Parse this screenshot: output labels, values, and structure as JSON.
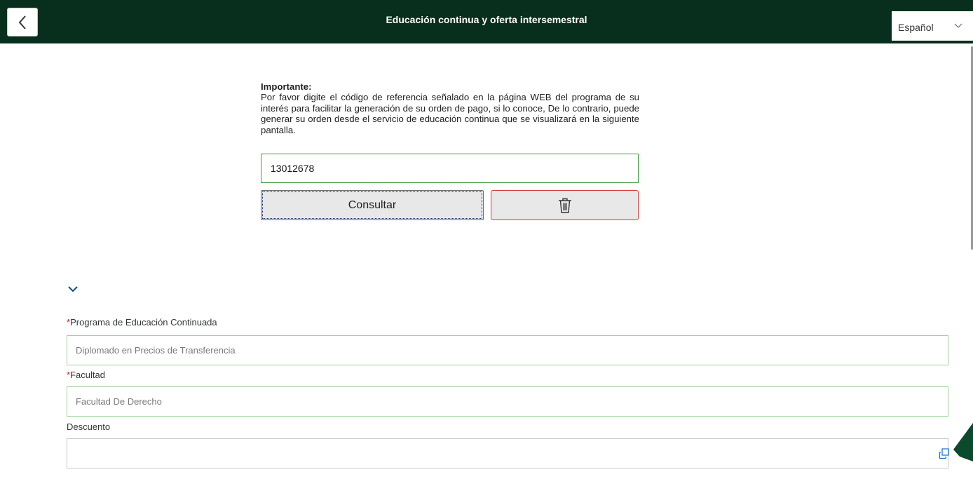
{
  "header": {
    "title": "Educación continua y oferta intersemestral",
    "language": "Español",
    "background_color": "#082f1d",
    "back_icon": "chevron-left-icon"
  },
  "notice": {
    "title": "Importante:",
    "body": "Por favor digite el código de referencia señalado en la página WEB del programa de su interés para facilitar la generación de su orden de pago, si lo conoce, De lo contrario, puede generar su orden desde el servicio de educación continua que se visualizará en la siguiente pantalla."
  },
  "reference": {
    "value": "13012678"
  },
  "actions": {
    "consult_label": "Consultar",
    "delete_icon": "trash-icon"
  },
  "form": {
    "collapse_icon": "chevron-down-icon",
    "program": {
      "required_mark": "*",
      "label": "Programa de Educación Continuada",
      "value": "Diplomado en Precios de Transferencia"
    },
    "faculty": {
      "required_mark": "*",
      "label": "Facultad",
      "value": "Facultad De Derecho"
    },
    "discount": {
      "label": "Descuento",
      "value": "",
      "value_help_icon": "value-help-icon"
    }
  },
  "colors": {
    "accent": "#082f1d",
    "valid_border": "#9fd39c",
    "error_border": "#d23a3a",
    "required": "#c62828"
  }
}
